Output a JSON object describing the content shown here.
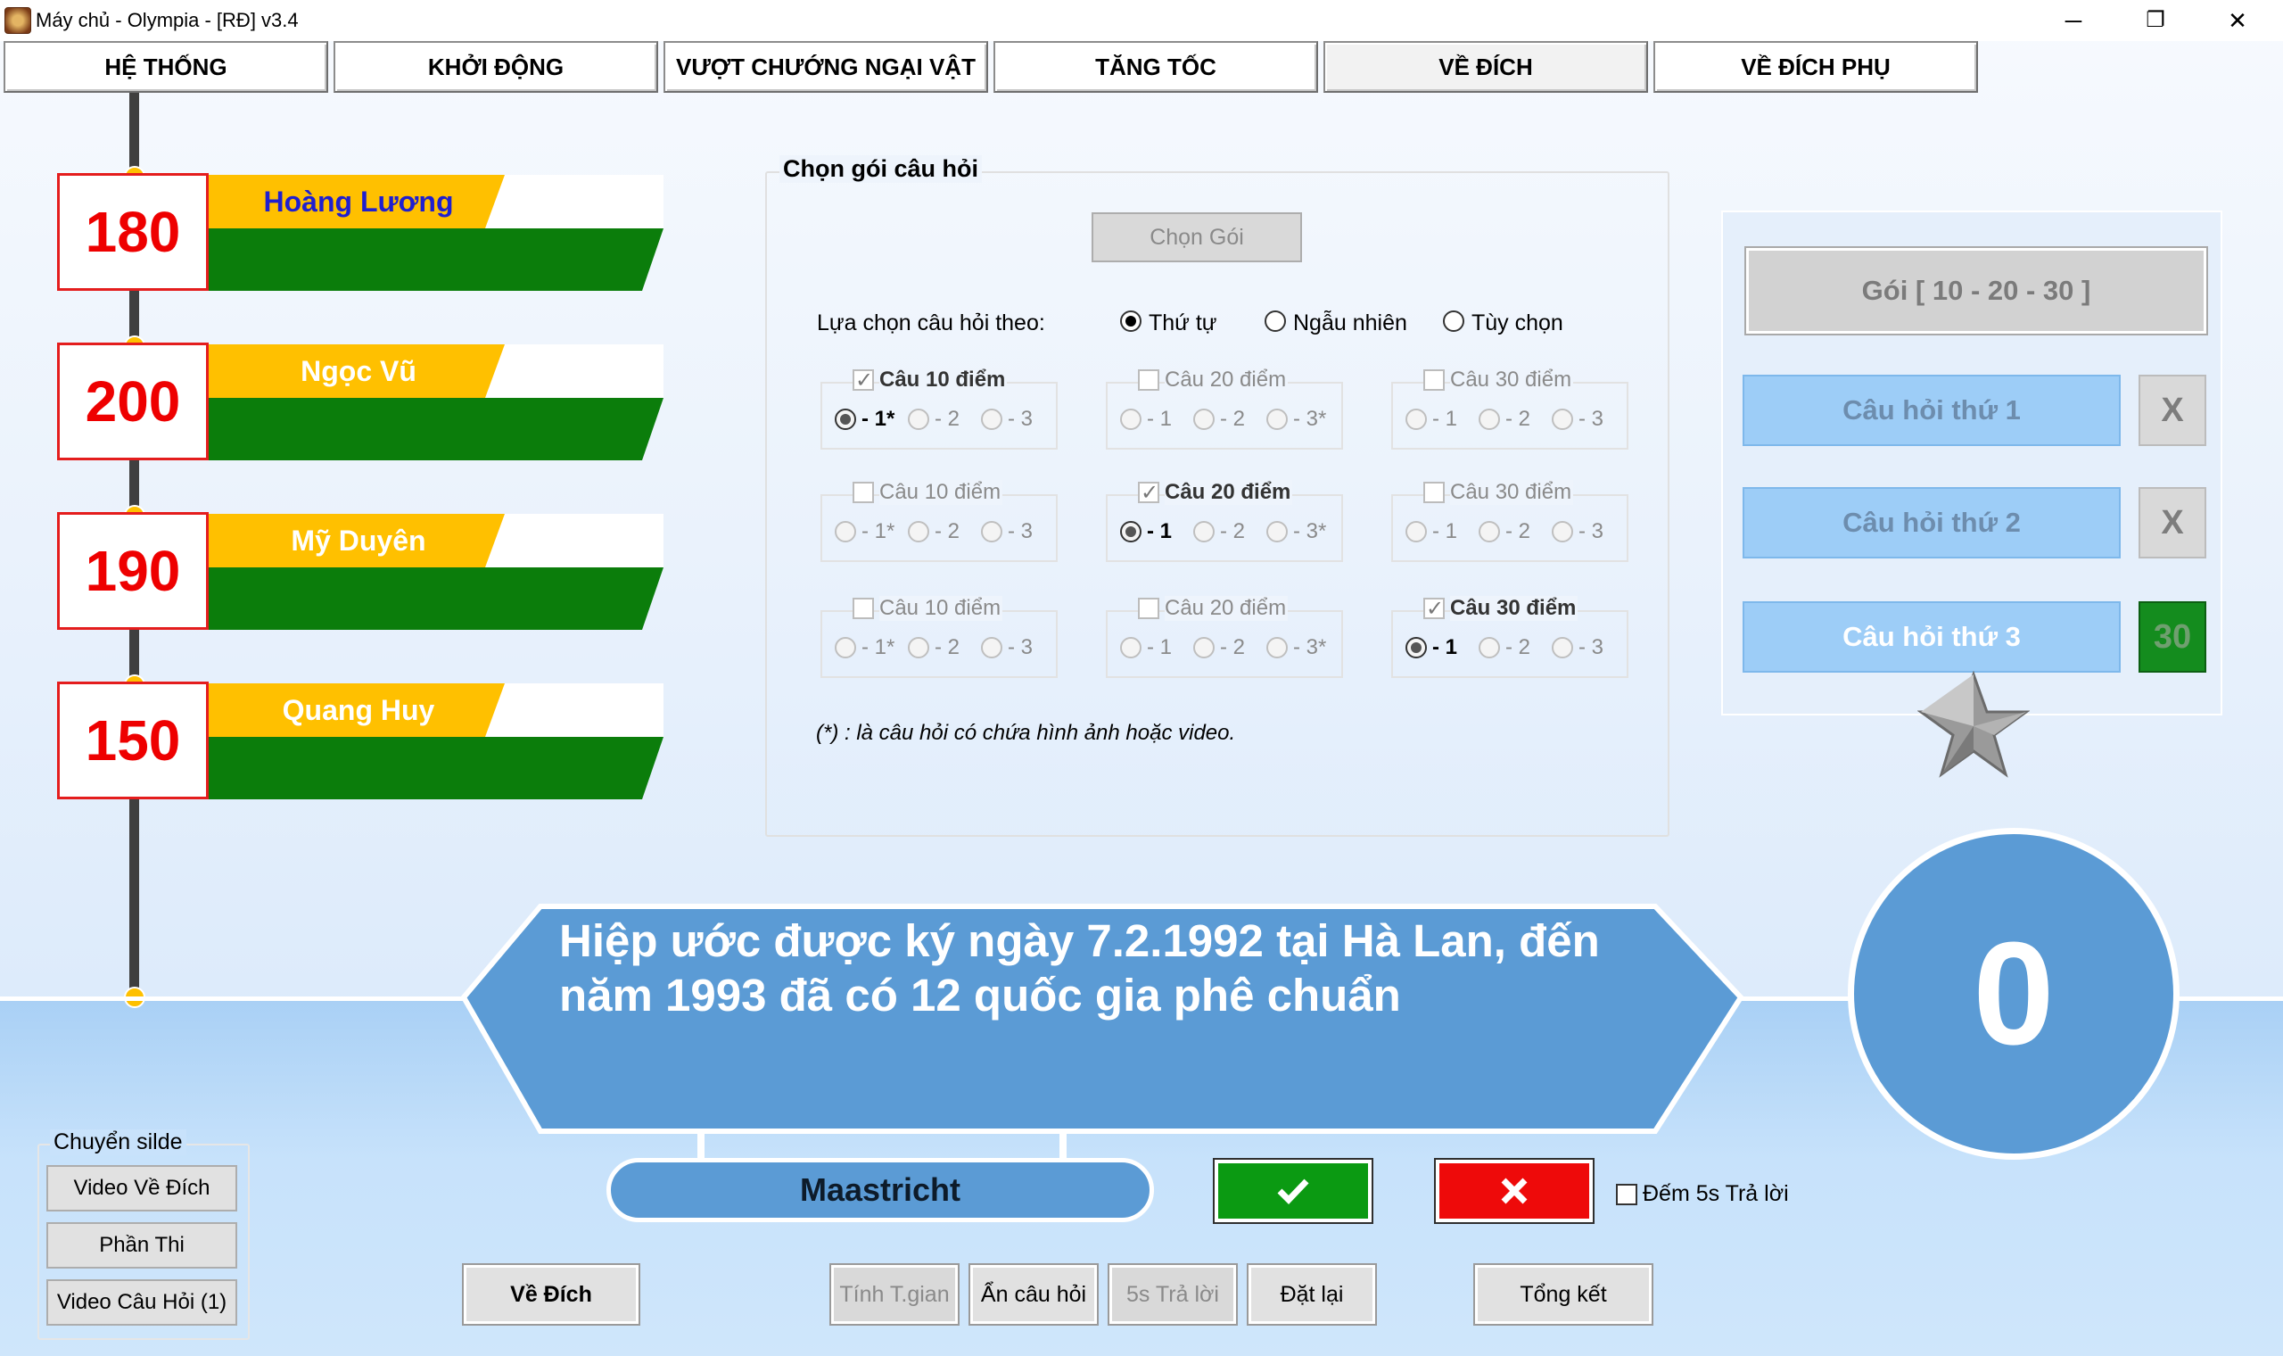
{
  "window": {
    "title": "Máy chủ - Olympia - [RĐ] v3.4",
    "minimize": "─",
    "maximize": "❐",
    "close": "✕"
  },
  "tabs": [
    {
      "label": "HỆ THỐNG"
    },
    {
      "label": "KHỞI ĐỘNG"
    },
    {
      "label": "VƯỢT CHƯỚNG NGẠI VẬT"
    },
    {
      "label": "TĂNG TỐC"
    },
    {
      "label": "VỀ ĐÍCH",
      "active": true
    },
    {
      "label": "VỀ ĐÍCH PHỤ"
    }
  ],
  "players": [
    {
      "score": "180",
      "name": "Hoàng Lương",
      "name_color": "#1f1fcf"
    },
    {
      "score": "200",
      "name": "Ngọc Vũ",
      "name_color": "#ffffff"
    },
    {
      "score": "190",
      "name": "Mỹ Duyên",
      "name_color": "#ffffff"
    },
    {
      "score": "150",
      "name": "Quang Huy",
      "name_color": "#ffffff"
    }
  ],
  "package_panel": {
    "title": "Chọn gói câu hỏi",
    "choose_button": "Chọn Gói",
    "select_by_label": "Lựa chọn câu hỏi theo:",
    "select_modes": [
      {
        "label": "Thứ tự",
        "checked": true
      },
      {
        "label": "Ngẫu nhiên",
        "checked": false
      },
      {
        "label": "Tùy chọn",
        "checked": false
      }
    ],
    "rows": [
      [
        {
          "title": "Câu 10 điểm",
          "checked": true,
          "options": [
            "- 1*",
            "- 2",
            "- 3"
          ],
          "selected": 0
        },
        {
          "title": "Câu 20 điểm",
          "checked": false,
          "options": [
            "- 1",
            "- 2",
            "- 3*"
          ],
          "selected": -1
        },
        {
          "title": "Câu 30 điểm",
          "checked": false,
          "options": [
            "- 1",
            "- 2",
            "- 3"
          ],
          "selected": -1
        }
      ],
      [
        {
          "title": "Câu 10 điểm",
          "checked": false,
          "options": [
            "- 1*",
            "- 2",
            "- 3"
          ],
          "selected": -1
        },
        {
          "title": "Câu 20 điểm",
          "checked": true,
          "options": [
            "- 1",
            "- 2",
            "- 3*"
          ],
          "selected": 0
        },
        {
          "title": "Câu 30 điểm",
          "checked": false,
          "options": [
            "- 1",
            "- 2",
            "- 3"
          ],
          "selected": -1
        }
      ],
      [
        {
          "title": "Câu 10 điểm",
          "checked": false,
          "options": [
            "- 1*",
            "- 2",
            "- 3"
          ],
          "selected": -1
        },
        {
          "title": "Câu 20 điểm",
          "checked": false,
          "options": [
            "- 1",
            "- 2",
            "- 3*"
          ],
          "selected": -1
        },
        {
          "title": "Câu 30 điểm",
          "checked": true,
          "options": [
            "- 1",
            "- 2",
            "- 3"
          ],
          "selected": 0
        }
      ]
    ],
    "note": "(*) : là câu hỏi có chứa hình ảnh hoặc video."
  },
  "right_panel": {
    "package_label": "Gói [ 10 - 20 - 30 ]",
    "questions": [
      {
        "label": "Câu hỏi thứ 1",
        "status": "X"
      },
      {
        "label": "Câu hỏi thứ 2",
        "status": "X"
      },
      {
        "label": "Câu hỏi thứ 3",
        "status": "30"
      }
    ]
  },
  "question": {
    "text": "Hiệp ước được ký ngày 7.2.1992 tại Hà Lan, đến năm 1993 đã có 12 quốc gia phê chuẩn"
  },
  "timer": {
    "value": "0"
  },
  "answer": {
    "text": "Maastricht"
  },
  "count5s_label": "Đếm 5s Trả lời",
  "slide": {
    "title": "Chuyển silde",
    "buttons": [
      "Video Về Đích",
      "Phần Thi",
      "Video Câu Hỏi (1)"
    ]
  },
  "bottom_buttons": {
    "ve_dich": "Về Đích",
    "tinh_tgian": "Tính T.gian",
    "an_cau_hoi": "Ẩn câu hỏi",
    "tra_loi_5s": "5s Trả lời",
    "dat_lai": "Đặt lại",
    "tong_ket": "Tổng kết"
  },
  "colors": {
    "accent_blue": "#5b9bd5",
    "score_red": "#ee0000",
    "name_yellow": "#ffc000",
    "bar_green": "#0b7d0b"
  }
}
